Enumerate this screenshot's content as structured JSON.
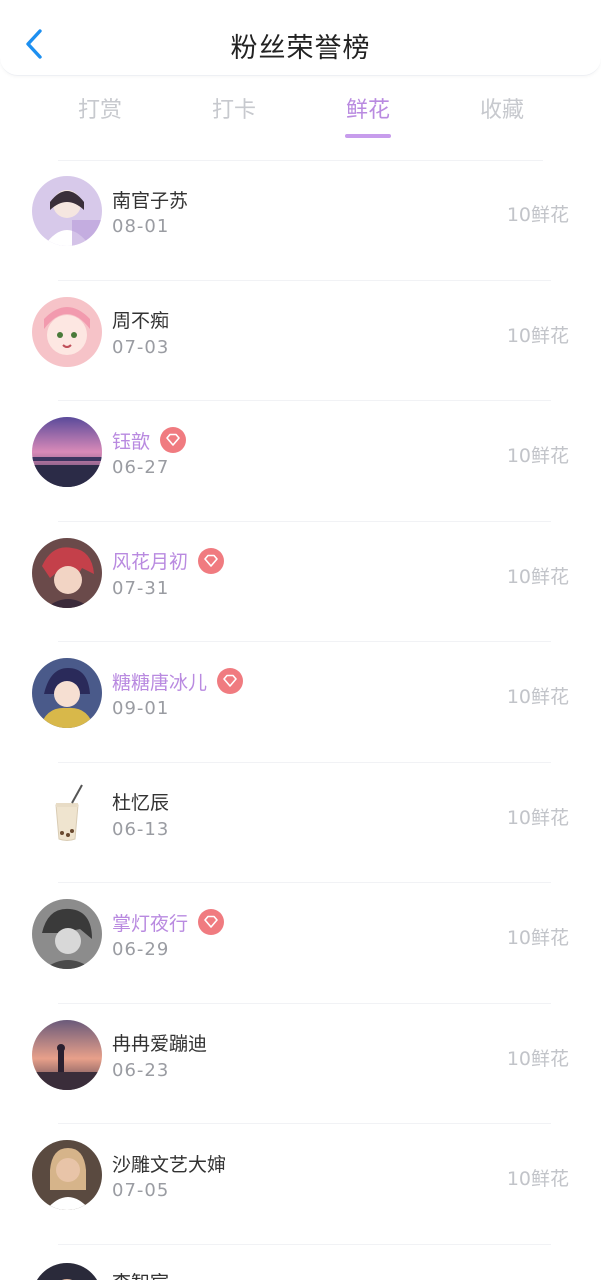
{
  "header": {
    "title": "粉丝荣誉榜",
    "back_icon": "chevron-left-icon"
  },
  "tabs": [
    {
      "label": "打赏",
      "active": false
    },
    {
      "label": "打卡",
      "active": false
    },
    {
      "label": "鲜花",
      "active": true
    },
    {
      "label": "收藏",
      "active": false
    }
  ],
  "colors": {
    "accent": "#b98ae0",
    "back": "#1d8ff0",
    "badge": "#f07b80"
  },
  "rows": [
    {
      "name": "南官子苏",
      "date": "08-01",
      "amount": "10鲜花",
      "vip": false
    },
    {
      "name": "周不痴",
      "date": "07-03",
      "amount": "10鲜花",
      "vip": false
    },
    {
      "name": "钰歆",
      "date": "06-27",
      "amount": "10鲜花",
      "vip": true
    },
    {
      "name": "风花月初",
      "date": "07-31",
      "amount": "10鲜花",
      "vip": true
    },
    {
      "name": "糖糖唐冰儿",
      "date": "09-01",
      "amount": "10鲜花",
      "vip": true
    },
    {
      "name": "杜忆辰",
      "date": "06-13",
      "amount": "10鲜花",
      "vip": false
    },
    {
      "name": "掌灯夜行",
      "date": "06-29",
      "amount": "10鲜花",
      "vip": true
    },
    {
      "name": "冉冉爱蹦迪",
      "date": "06-23",
      "amount": "10鲜花",
      "vip": false
    },
    {
      "name": "沙雕文艺大婶",
      "date": "07-05",
      "amount": "10鲜花",
      "vip": false
    }
  ],
  "partial_row": {
    "name": "李智宸"
  }
}
